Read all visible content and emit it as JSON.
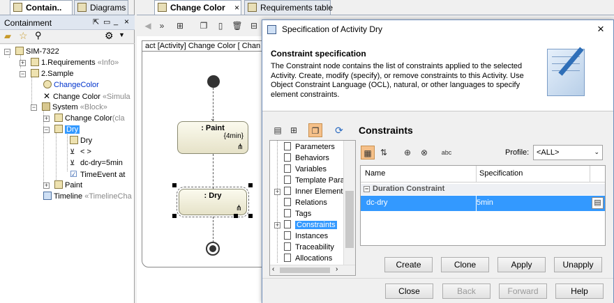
{
  "left_panel": {
    "tabs": [
      "Contain..",
      "Diagrams"
    ],
    "title": "Containment",
    "tree": [
      {
        "label": "SIM-7322",
        "suffix": ""
      },
      {
        "label": "1.Requirements",
        "suffix": "«Info»"
      },
      {
        "label": "2.Sample",
        "suffix": ""
      },
      {
        "label": "ChangeColor",
        "suffix": ""
      },
      {
        "label": "Change Color",
        "suffix": "«Simula"
      },
      {
        "label": "System",
        "suffix": "«Block»"
      },
      {
        "label": "Change Color",
        "suffix": "(cla"
      },
      {
        "label": "Dry",
        "suffix": ""
      },
      {
        "label": "Dry",
        "suffix": ""
      },
      {
        "label": "< >",
        "suffix": ""
      },
      {
        "label": "dc-dry=5min",
        "suffix": ""
      },
      {
        "label": "TimeEvent at",
        "suffix": ""
      },
      {
        "label": "Paint",
        "suffix": ""
      },
      {
        "label": "Timeline",
        "suffix": "«TimelineCha"
      }
    ]
  },
  "editor": {
    "tabs": [
      "Change Color",
      "Requirements table"
    ],
    "close_glyph": "×",
    "diagram_header": "act [Activity] Change Color [ Chan",
    "nodes": {
      "paint_title": ": Paint",
      "paint_duration": "{4min}",
      "dry_title": ": Dry"
    }
  },
  "dialog": {
    "title": "Specification of Activity Dry",
    "header_title": "Constraint specification",
    "header_text": "The Constraint node contains the list of constraints applied to the selected Activity. Create, modify (specify), or remove constraints to this Activity. Use Object Constraint Language (OCL), natural, or other languages to specify element constraints.",
    "nav_items": [
      "Parameters",
      "Behaviors",
      "Variables",
      "Template Para",
      "Inner Element",
      "Relations",
      "Tags",
      "Constraints",
      "Instances",
      "Traceability",
      "Allocations"
    ],
    "selected_nav": "Constraints",
    "section_title": "Constraints",
    "profile_label": "Profile:",
    "profile_value": "<ALL>",
    "columns": [
      "Name",
      "Specification"
    ],
    "group_label": "Duration Constraint",
    "row": {
      "name": "dc-dry",
      "spec": "5min"
    },
    "action_buttons": [
      "Create",
      "Clone",
      "Apply",
      "Unapply"
    ],
    "footer_buttons": [
      "Close",
      "Back",
      "Forward",
      "Help"
    ],
    "selection_color": "#3399ff"
  }
}
